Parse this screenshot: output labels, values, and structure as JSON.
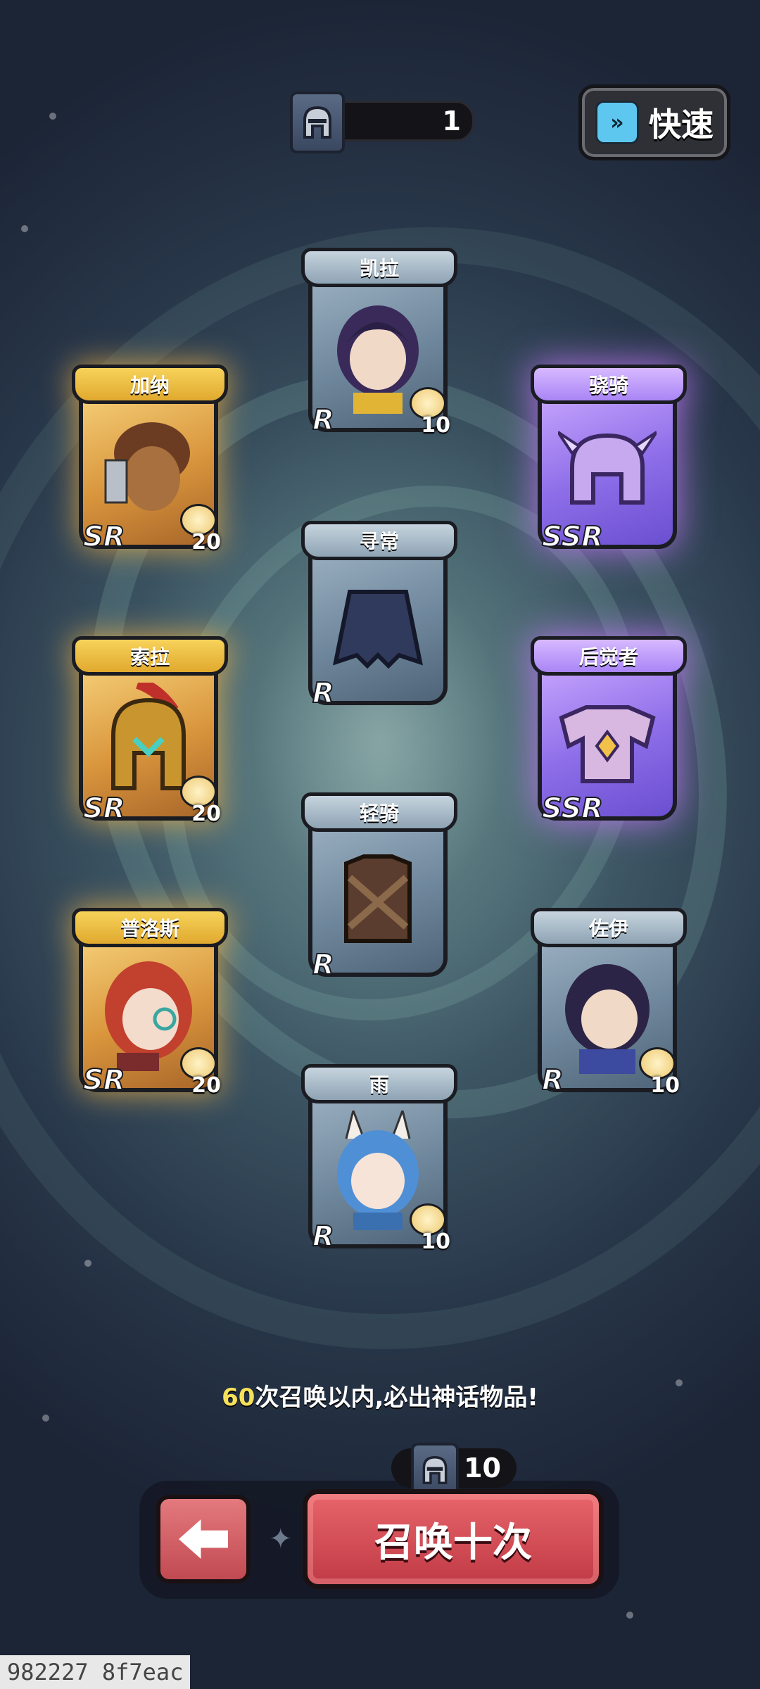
{
  "top": {
    "summon_tickets": "1",
    "quick_label": "快速"
  },
  "cards": [
    {
      "name": "凯拉",
      "rarity": "R",
      "count": "10",
      "kind": "hero",
      "color": "#6b4c8f"
    },
    {
      "name": "加纳",
      "rarity": "SR",
      "count": "20",
      "kind": "hero",
      "color": "#7a4a2a"
    },
    {
      "name": "骁骑",
      "rarity": "SSR",
      "count": "",
      "kind": "helmet",
      "color": "#e0c8ff"
    },
    {
      "name": "寻常",
      "rarity": "R",
      "count": "",
      "kind": "skirt",
      "color": "#2f3a5c"
    },
    {
      "name": "索拉",
      "rarity": "SR",
      "count": "20",
      "kind": "hero",
      "color": "#c9952e"
    },
    {
      "name": "后觉者",
      "rarity": "SSR",
      "count": "",
      "kind": "armor",
      "color": "#e8c8e8"
    },
    {
      "name": "轻骑",
      "rarity": "R",
      "count": "",
      "kind": "vest",
      "color": "#5a3d2e"
    },
    {
      "name": "普洛斯",
      "rarity": "SR",
      "count": "20",
      "kind": "hero",
      "color": "#c2402e"
    },
    {
      "name": "佐伊",
      "rarity": "R",
      "count": "10",
      "kind": "hero",
      "color": "#3a3a6a"
    },
    {
      "name": "雨",
      "rarity": "R",
      "count": "10",
      "kind": "hero",
      "color": "#4f8fd6"
    }
  ],
  "footer": {
    "hint_number": "60",
    "hint_text": "次召唤以内,必出神话物品!",
    "cost": "10",
    "summon_label": "召唤十次"
  },
  "watermark": "982227 8f7eac"
}
